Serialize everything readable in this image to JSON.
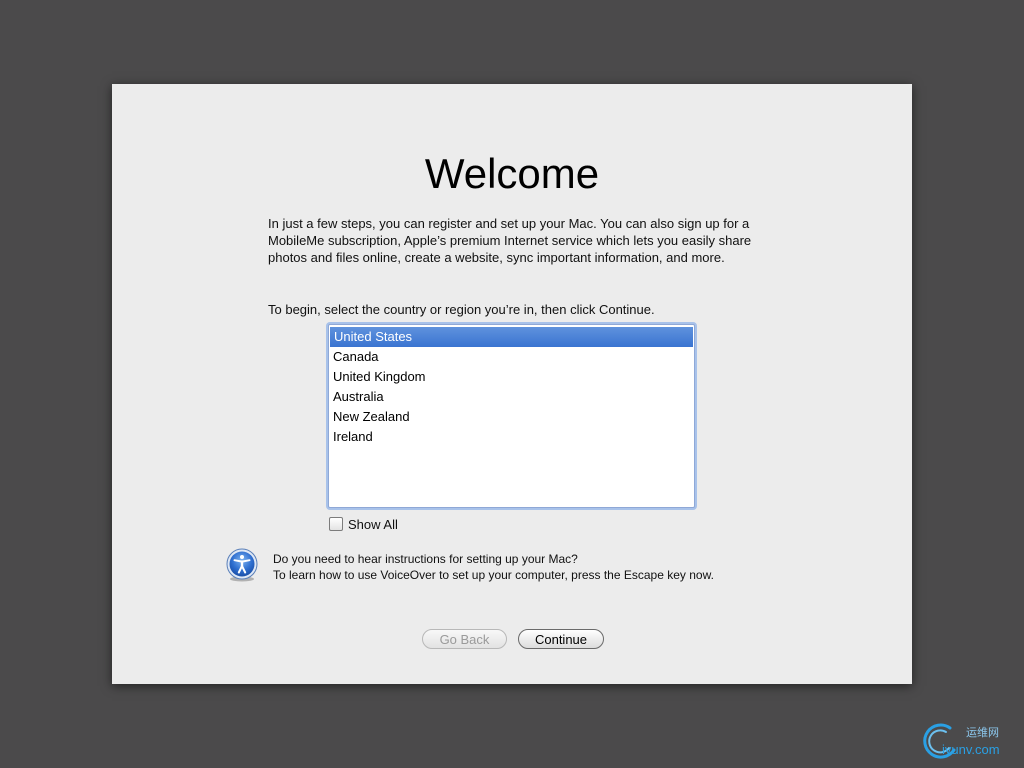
{
  "welcome": {
    "title": "Welcome",
    "intro": "In just a few steps, you can register and set up your Mac. You can also sign up for a MobileMe subscription, Apple’s premium Internet service which lets you easily share photos and files online, create a website, sync important information, and more.",
    "instruction": "To begin, select the country or region you’re in, then click Continue."
  },
  "countries": {
    "selected": "United States",
    "items": [
      {
        "label": "United States"
      },
      {
        "label": "Canada"
      },
      {
        "label": "United Kingdom"
      },
      {
        "label": "Australia"
      },
      {
        "label": "New Zealand"
      },
      {
        "label": "Ireland"
      }
    ]
  },
  "show_all": {
    "label": "Show All",
    "checked": false
  },
  "voiceover": {
    "icon": "accessibility-icon",
    "line1": "Do you need to hear instructions for setting up your Mac?",
    "line2": "To learn how to use VoiceOver to set up your computer, press the Escape key now."
  },
  "buttons": {
    "back_label": "Go Back",
    "back_enabled": false,
    "continue_label": "Continue"
  },
  "watermark": {
    "text": "iyunv.com",
    "chinese": "运维网"
  },
  "colors": {
    "desktop": "#4b4a4b",
    "panel": "#ececec",
    "selection": "#3a74d1",
    "watermark": "#2aa0e4"
  }
}
